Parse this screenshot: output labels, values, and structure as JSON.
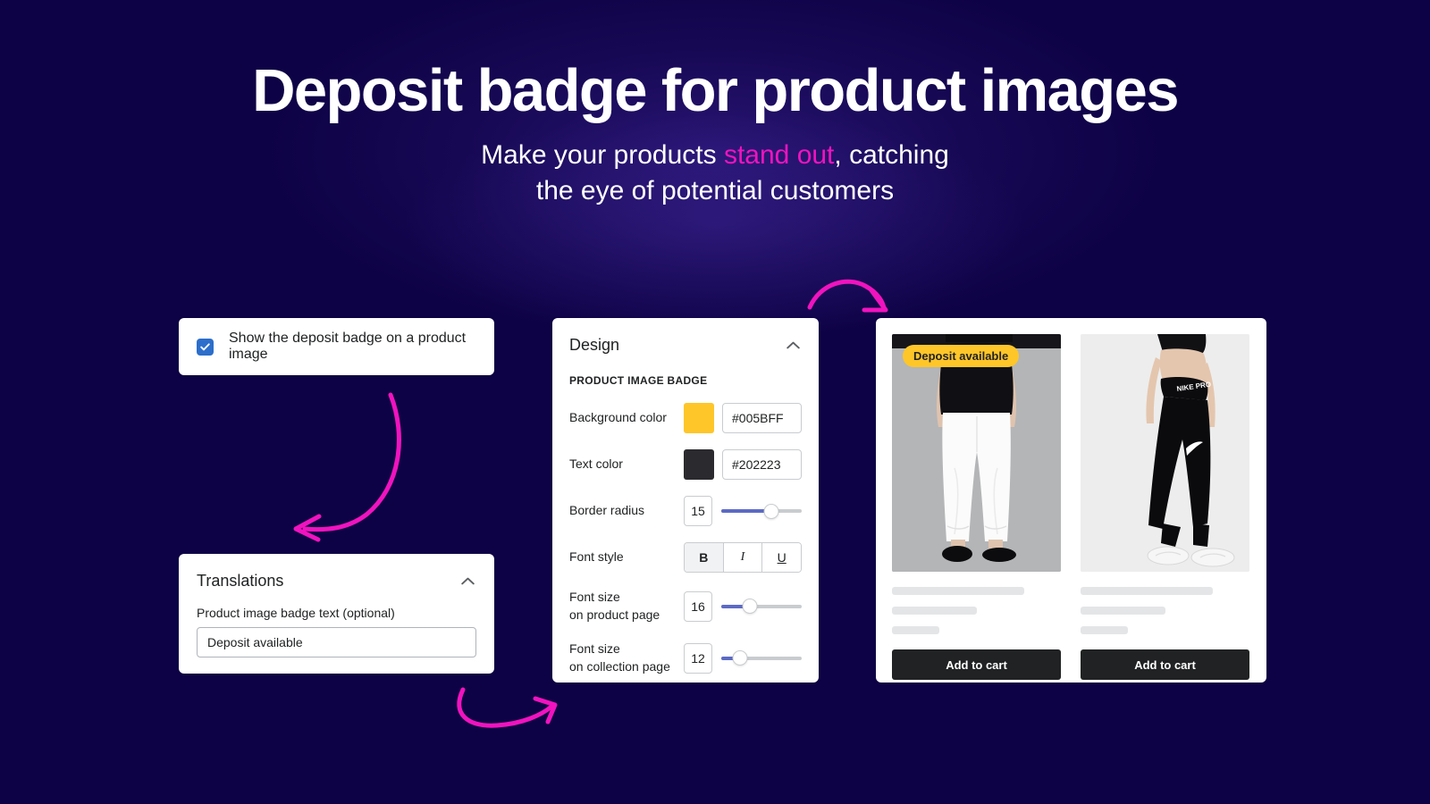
{
  "theme": {
    "background": "#0E0246",
    "accent_pink": "#F013BE",
    "badge_yellow": "#FFC629",
    "slider_blue": "#5C6AC4",
    "checkbox_blue": "#2C6ECB",
    "text_dark": "#202223"
  },
  "hero": {
    "title": "Deposit badge for product images",
    "subtitle_part1": "Make your products ",
    "subtitle_accent": "stand out",
    "subtitle_part2": ", catching",
    "subtitle_line2": "the eye of potential customers"
  },
  "checkbox_card": {
    "label": "Show the deposit badge on a product image",
    "checked": true
  },
  "translations_card": {
    "title": "Translations",
    "collapse_icon": "chevron-up-icon",
    "field_label": "Product image badge text (optional)",
    "field_value": "Deposit available",
    "field_placeholder": "Deposit available"
  },
  "design_card": {
    "title": "Design",
    "collapse_icon": "chevron-up-icon",
    "section_label": "PRODUCT IMAGE BADGE",
    "rows": [
      {
        "label": "Background color",
        "type": "color",
        "swatch": "#FFC629",
        "value": "#005BFF"
      },
      {
        "label": "Text color",
        "type": "color",
        "swatch": "#2B2B2F",
        "value": "#202223"
      },
      {
        "label": "Border radius",
        "type": "slider",
        "value": "15",
        "percent": 62
      },
      {
        "label": "Font style",
        "type": "segmented",
        "options": [
          {
            "label": "B",
            "name": "bold",
            "active": true
          },
          {
            "label": "I",
            "name": "italic",
            "active": false
          },
          {
            "label": "U",
            "name": "underline",
            "active": false
          }
        ]
      },
      {
        "label_line1": "Font size",
        "label_line2": "on product page",
        "type": "slider",
        "value": "16",
        "percent": 36
      },
      {
        "label_line1": "Font size",
        "label_line2": "on collection page",
        "type": "slider",
        "value": "12",
        "percent": 23
      }
    ]
  },
  "preview_card": {
    "products": [
      {
        "badge_text": "Deposit available",
        "has_badge": true,
        "add_to_cart": "Add to cart",
        "image_alt": "woman-white-trousers-photo"
      },
      {
        "badge_text": "",
        "has_badge": false,
        "add_to_cart": "Add to cart",
        "image_alt": "woman-black-leggings-photo"
      }
    ]
  },
  "arrows": [
    {
      "name": "arrow-checkbox-to-translations"
    },
    {
      "name": "arrow-top-to-preview"
    },
    {
      "name": "arrow-translations-to-design"
    }
  ]
}
